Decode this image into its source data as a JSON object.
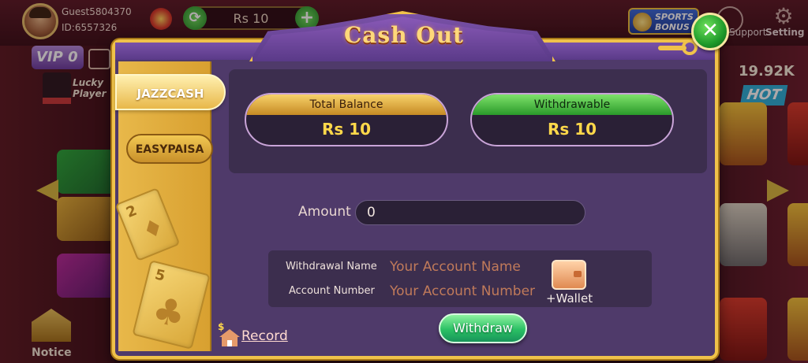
{
  "lobby": {
    "guest_name": "Guest5804370",
    "guest_id": "ID:6557326",
    "balance": "Rs  10",
    "sports_bonus_line1": "SPORTS",
    "sports_bonus_line2": "BONUS",
    "support_label": "Support",
    "settings_label": "Setting",
    "vip_label": "VIP 0",
    "lucky_player_label": "Lucky Player",
    "right_amount": "19.92K",
    "hot_label": "HOT",
    "notice_label": "Notice"
  },
  "modal": {
    "title": "Cash Out",
    "close_glyph": "✕",
    "tabs": [
      {
        "label": "JAZZCASH",
        "active": true
      },
      {
        "label": "EASYPAISA",
        "active": false
      }
    ],
    "cards": [
      {
        "rank": "2",
        "suit": "♦"
      },
      {
        "rank": "5",
        "suit": "♣"
      }
    ],
    "total_balance": {
      "label": "Total Balance",
      "value": "Rs  10"
    },
    "withdrawable": {
      "label": "Withdrawable",
      "value": "Rs  10"
    },
    "amount": {
      "label": "Amount",
      "value": "0"
    },
    "account": {
      "name_label": "Withdrawal Name",
      "name_placeholder": "Your Account Name",
      "number_label": "Account Number",
      "number_placeholder": "Your Account Number",
      "wallet_label": "+Wallet"
    },
    "withdraw_label": "Withdraw",
    "record_label": "Record"
  },
  "icons": {
    "close": "close-icon",
    "wallet": "wallet-icon",
    "record": "record-icon",
    "refresh": "refresh-icon",
    "add": "add-icon",
    "settings": "gear-icon"
  },
  "colors": {
    "gold": "#f0c24a",
    "modal_bg": "#4f3a6a",
    "panel_bg": "#3c2e4e",
    "balance_value": "#ffd84a",
    "withdraw_green": "#2ac064"
  }
}
